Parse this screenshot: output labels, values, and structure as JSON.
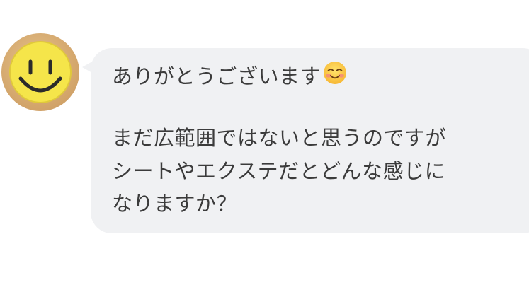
{
  "avatar": {
    "icon": "smiley-face-icon",
    "colors": {
      "frame": "#d6aa70",
      "face": "#f5e54a",
      "features": "#2b2b2b"
    }
  },
  "message": {
    "bubble_color": "#f0f1f3",
    "text_color": "#3b3b3b",
    "lines": [
      "ありがとうございます",
      "まだ広範囲ではないと思うのですが",
      "シートやエクステだとどんな感じに",
      "なりますか？"
    ],
    "emoji": "smiling-face-with-smiling-eyes-icon"
  }
}
